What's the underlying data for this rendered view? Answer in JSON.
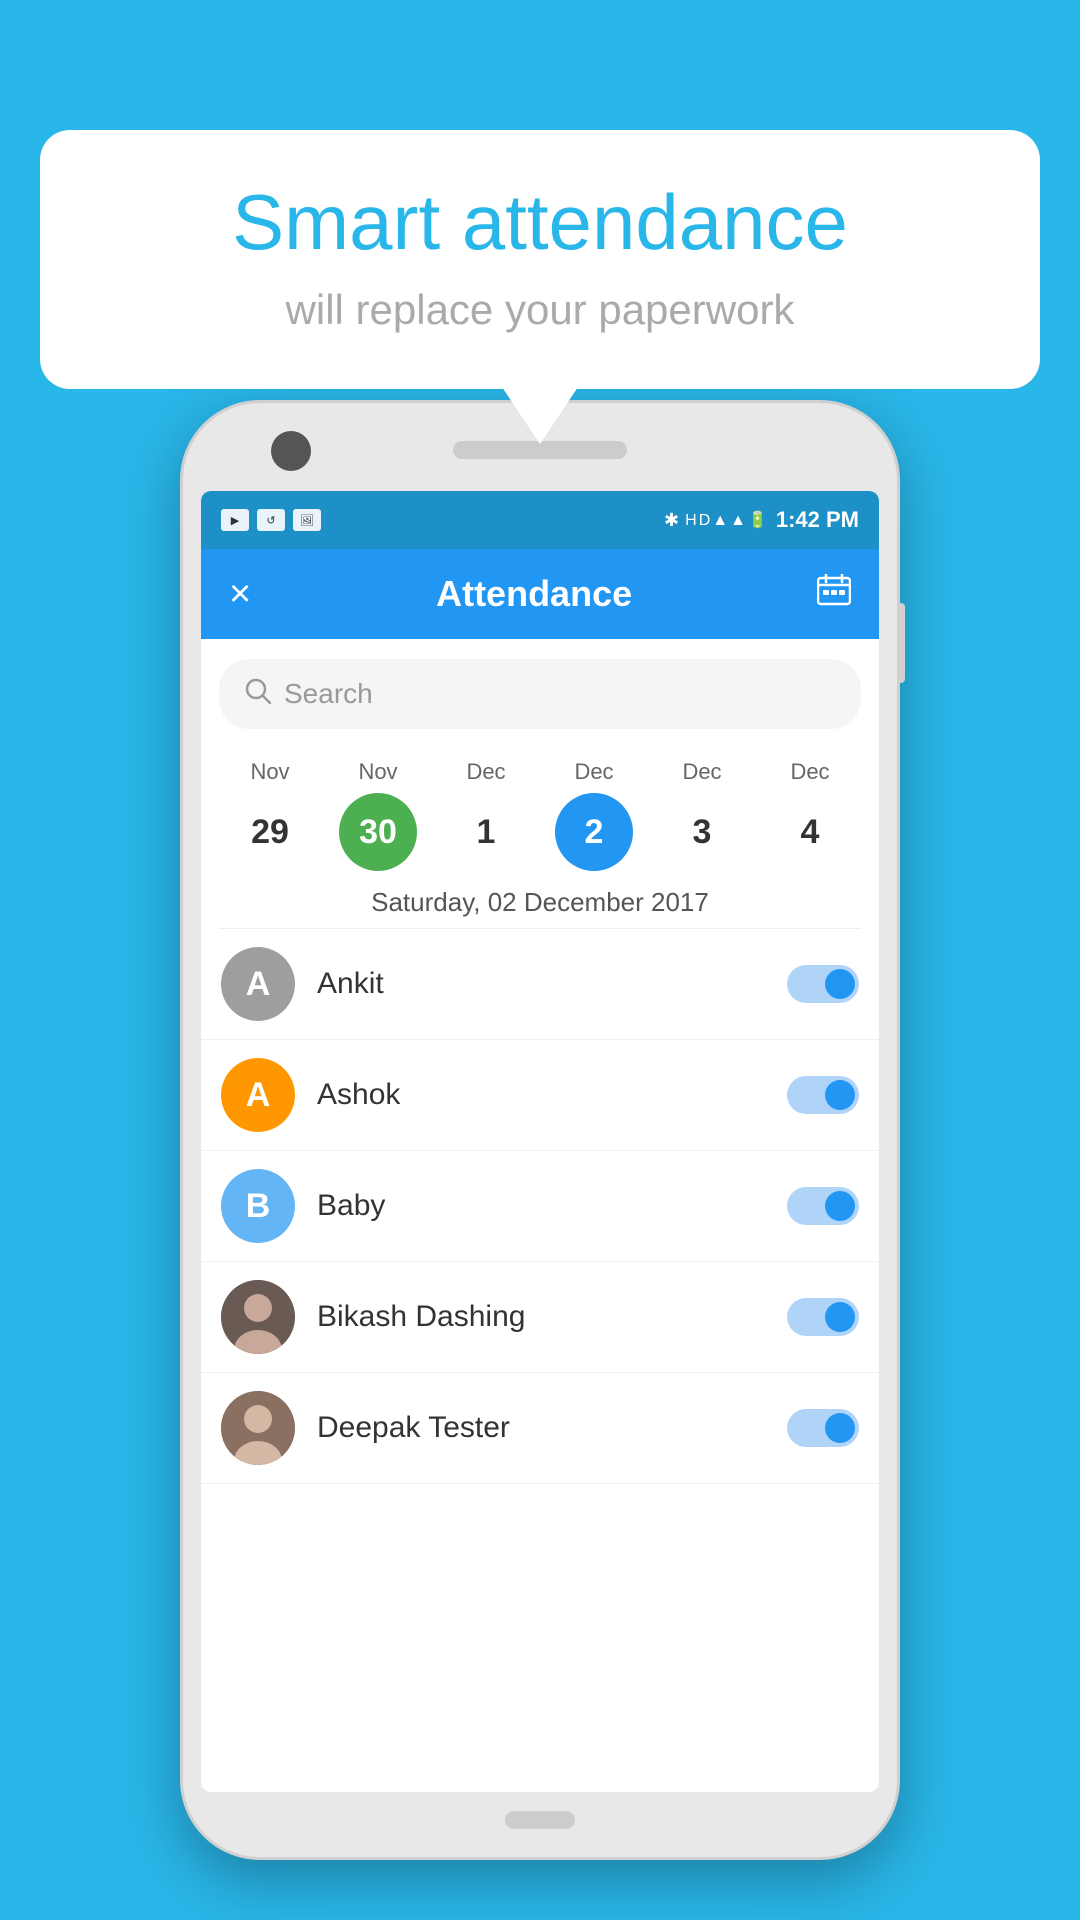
{
  "background_color": "#29b6e8",
  "bubble": {
    "title": "Smart attendance",
    "subtitle": "will replace your paperwork"
  },
  "status_bar": {
    "time": "1:42 PM",
    "icons_left": [
      "▶",
      "↻",
      "🖼"
    ],
    "icons_right": "✶ HD ▲▲ 🔋"
  },
  "header": {
    "close_label": "×",
    "title": "Attendance",
    "calendar_icon": "📅"
  },
  "search": {
    "placeholder": "Search"
  },
  "dates": [
    {
      "month": "Nov",
      "day": "29",
      "style": "plain"
    },
    {
      "month": "Nov",
      "day": "30",
      "style": "green"
    },
    {
      "month": "Dec",
      "day": "1",
      "style": "plain"
    },
    {
      "month": "Dec",
      "day": "2",
      "style": "blue"
    },
    {
      "month": "Dec",
      "day": "3",
      "style": "plain"
    },
    {
      "month": "Dec",
      "day": "4",
      "style": "plain"
    }
  ],
  "selected_date_label": "Saturday, 02 December 2017",
  "people": [
    {
      "name": "Ankit",
      "avatar_letter": "A",
      "avatar_style": "gray",
      "avatar_type": "letter",
      "toggle_on": true
    },
    {
      "name": "Ashok",
      "avatar_letter": "A",
      "avatar_style": "orange",
      "avatar_type": "letter",
      "toggle_on": true
    },
    {
      "name": "Baby",
      "avatar_letter": "B",
      "avatar_style": "lightblue",
      "avatar_type": "letter",
      "toggle_on": true
    },
    {
      "name": "Bikash Dashing",
      "avatar_letter": "",
      "avatar_style": "photo1",
      "avatar_type": "photo",
      "toggle_on": true
    },
    {
      "name": "Deepak Tester",
      "avatar_letter": "",
      "avatar_style": "photo2",
      "avatar_type": "photo",
      "toggle_on": true
    }
  ]
}
